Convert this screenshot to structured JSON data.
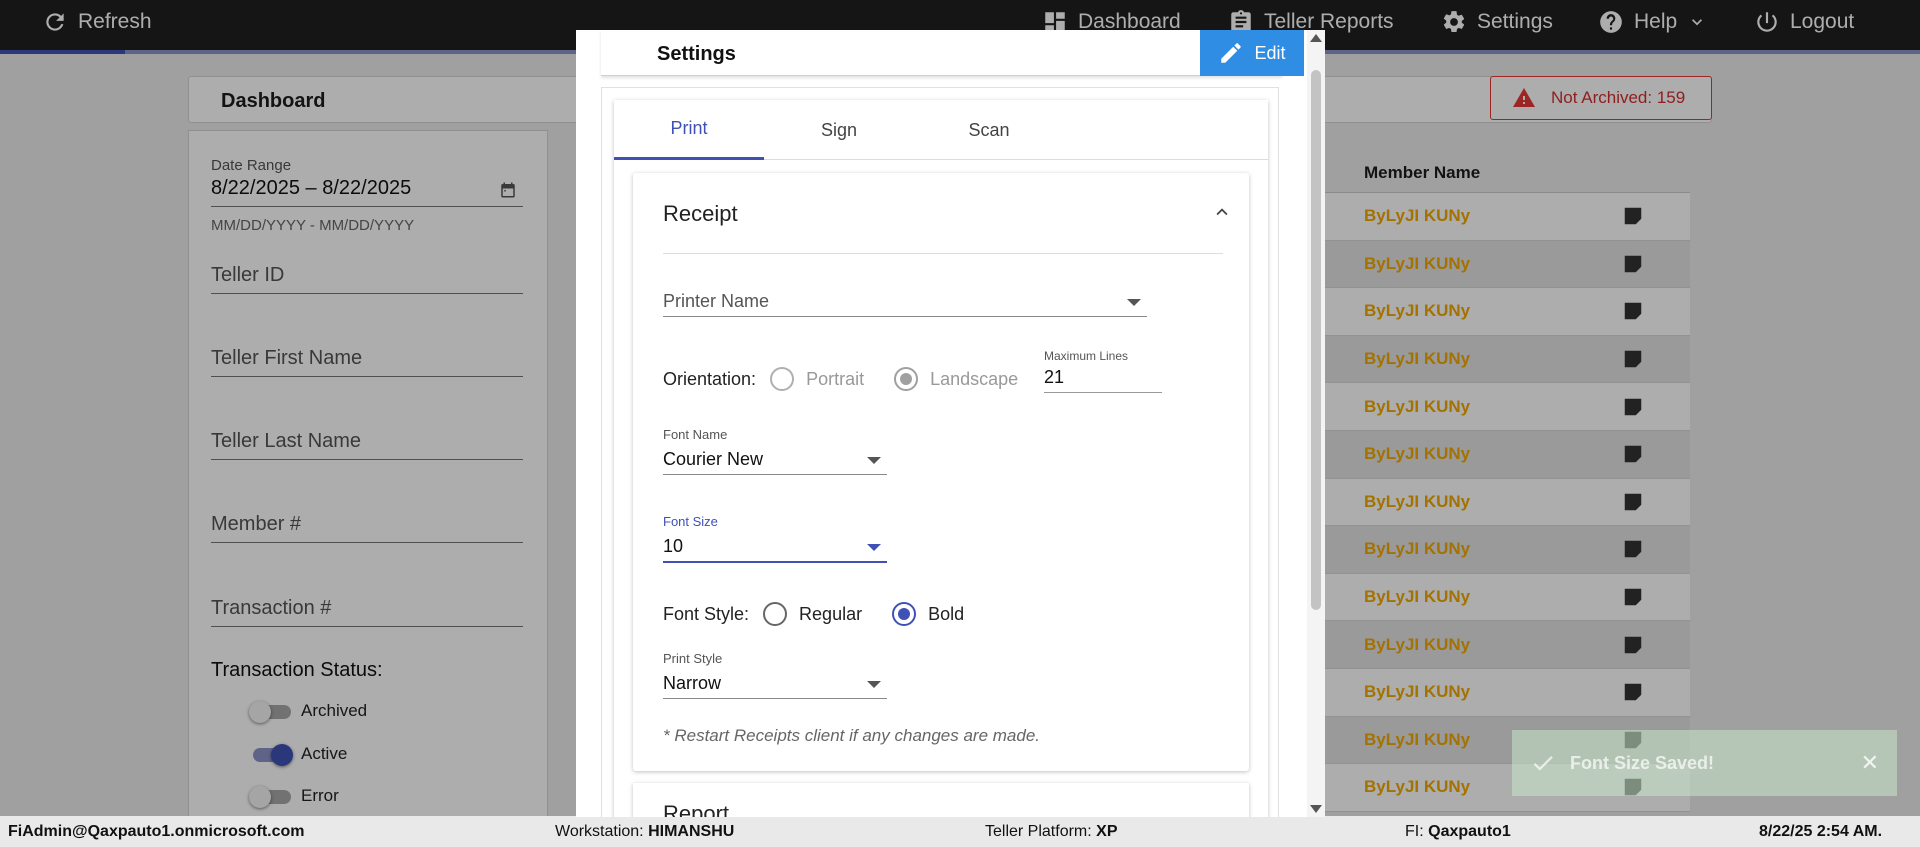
{
  "topbar": {
    "refresh": "Refresh",
    "nav": [
      "Dashboard",
      "Teller Reports",
      "Settings",
      "Help",
      "Logout"
    ],
    "loading_progress": 0.065
  },
  "dashboard": {
    "title": "Dashboard",
    "not_archived": "Not Archived: 159",
    "filters": {
      "date_range_label": "Date Range",
      "date_range_value": "8/22/2025 – 8/22/2025",
      "date_range_hint": "MM/DD/YYYY - MM/DD/YYYY",
      "teller_id": "Teller ID",
      "teller_first_name": "Teller First Name",
      "teller_last_name": "Teller Last Name",
      "member_num": "Member #",
      "transaction_num": "Transaction #",
      "status_title": "Transaction Status:",
      "statuses": [
        {
          "label": "Archived",
          "on": false
        },
        {
          "label": "Active",
          "on": true
        },
        {
          "label": "Error",
          "on": false
        }
      ]
    },
    "table": {
      "header_member_name": "Member Name",
      "rows": [
        "ByLyJI KUNy",
        "ByLyJI KUNy",
        "ByLyJI KUNy",
        "ByLyJI KUNy",
        "ByLyJI KUNy",
        "ByLyJI KUNy",
        "ByLyJI KUNy",
        "ByLyJI KUNy",
        "ByLyJI KUNy",
        "ByLyJI KUNy",
        "ByLyJI KUNy",
        "ByLyJI KUNy",
        "ByLyJI KUNy"
      ]
    }
  },
  "toast": {
    "message": "Font Size Saved!",
    "close": "✕"
  },
  "statusbar": {
    "user": "FiAdmin@Qaxpauto1.onmicrosoft.com",
    "workstation_label": "Workstation:",
    "workstation": "HIMANSHU",
    "platform_label": "Teller Platform:",
    "platform": "XP",
    "fi_label": "FI:",
    "fi": "Qaxpauto1",
    "datetime": "8/22/25 2:54 AM."
  },
  "modal": {
    "title": "Settings",
    "edit": "Edit",
    "tabs": [
      "Print",
      "Sign",
      "Scan"
    ],
    "receipt": {
      "title": "Receipt",
      "printer_name": "Printer Name",
      "orientation_label": "Orientation:",
      "portrait": "Portrait",
      "landscape": "Landscape",
      "max_lines_label": "Maximum Lines",
      "max_lines": "21",
      "font_name_label": "Font Name",
      "font_name": "Courier New",
      "font_size_label": "Font Size",
      "font_size": "10",
      "font_style_label": "Font Style:",
      "regular": "Regular",
      "bold": "Bold",
      "print_style_label": "Print Style",
      "print_style": "Narrow",
      "note": "* Restart Receipts client if any changes are made."
    },
    "next_section": "Report"
  },
  "colors": {
    "accent": "#3f51b5",
    "edit_button": "#2f8de4",
    "warning": "#d32f2f",
    "member_name": "#f0a800"
  }
}
